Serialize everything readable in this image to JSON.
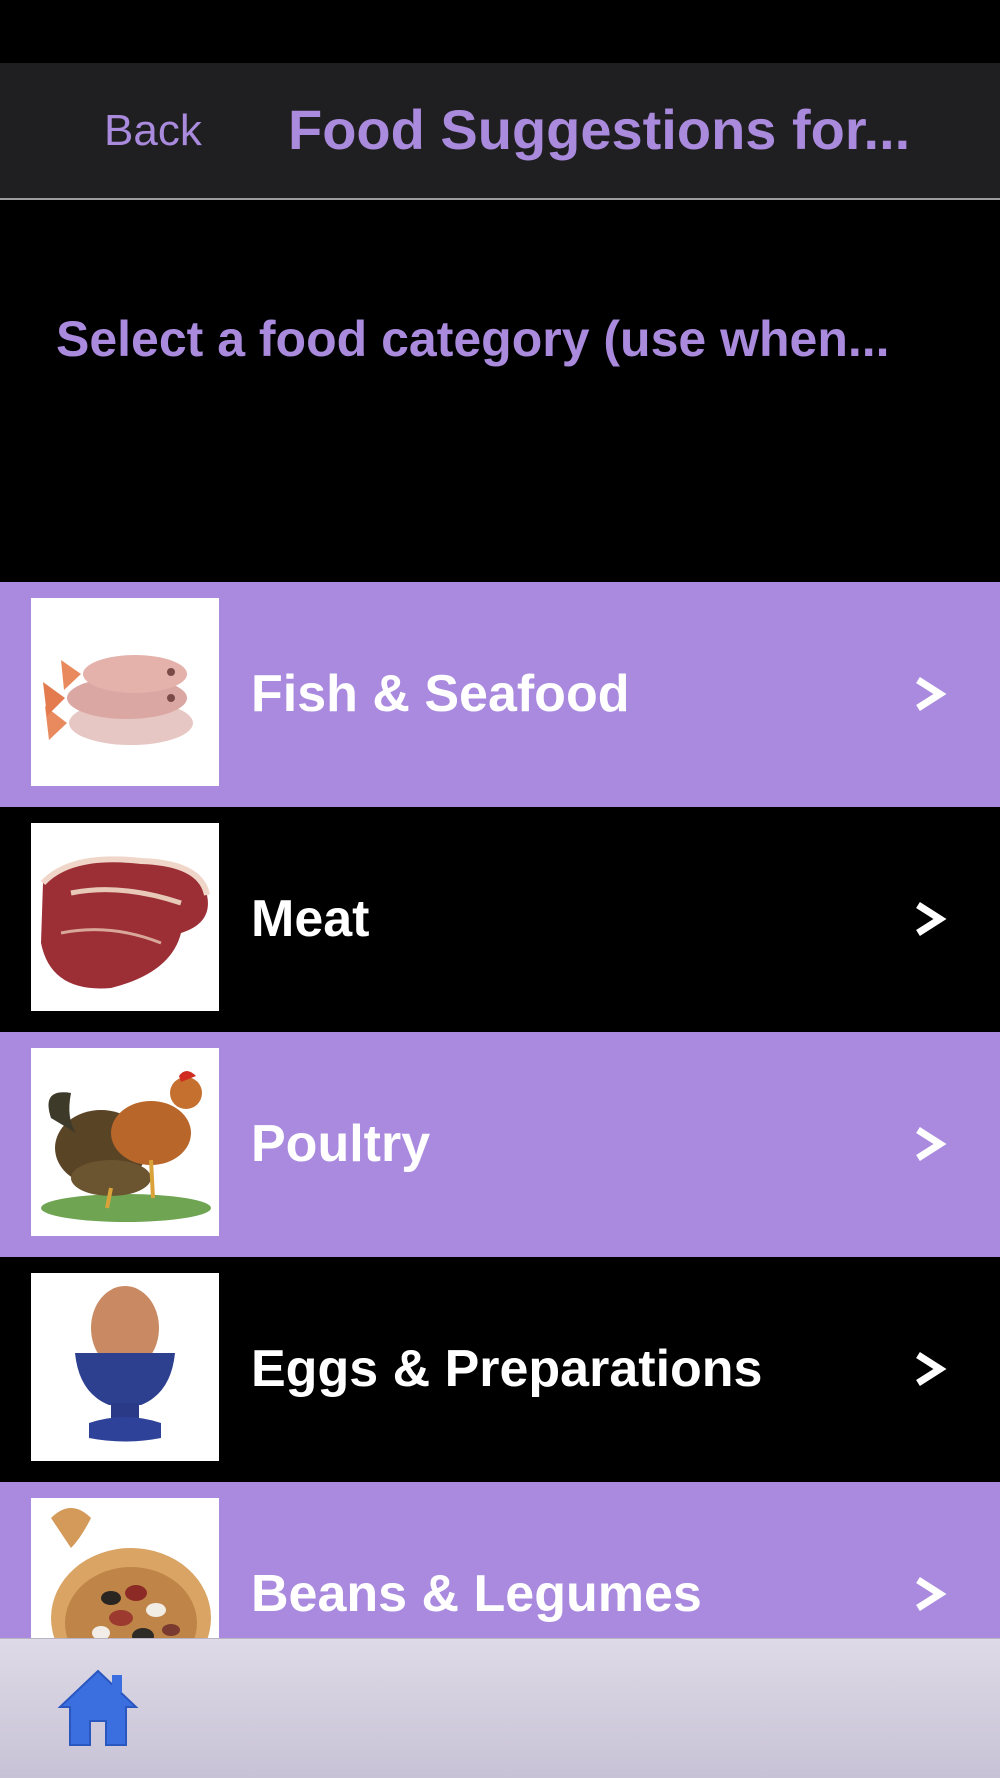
{
  "nav": {
    "back_label": "Back",
    "title": "Food Suggestions for..."
  },
  "prompt": "Select a food category (use when...",
  "categories": [
    {
      "label": "Fish & Seafood",
      "icon": "fish-image"
    },
    {
      "label": "Meat",
      "icon": "steak-image"
    },
    {
      "label": "Poultry",
      "icon": "chicken-image"
    },
    {
      "label": "Eggs & Preparations",
      "icon": "egg-cup-image"
    },
    {
      "label": "Beans & Legumes",
      "icon": "beans-spoon-image"
    }
  ],
  "chevron": "chevron-right-icon",
  "tabbar": {
    "home_icon": "home-icon"
  },
  "colors": {
    "accent": "#a98ade",
    "row_alt": "#000000",
    "nav_bg": "#1f1f21",
    "home_blue": "#3b6fe0"
  }
}
